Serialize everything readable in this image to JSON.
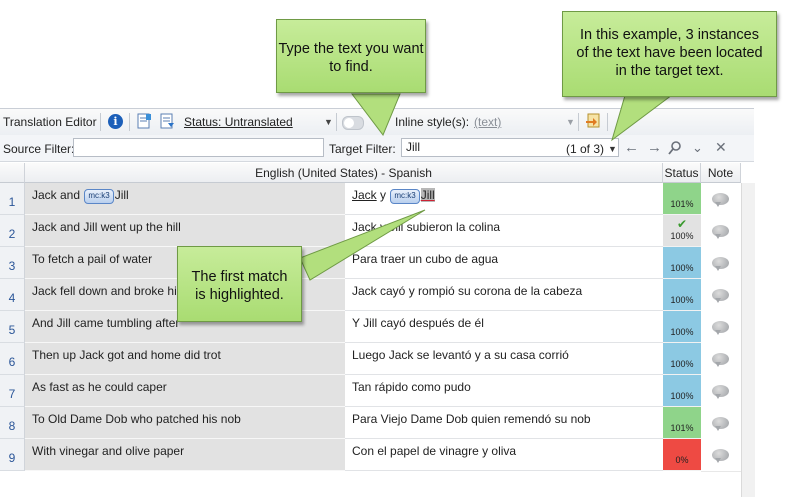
{
  "toolbar": {
    "title": "Translation Editor",
    "status_label": "Status: Untranslated",
    "inline_styles_label": "Inline style(s):",
    "inline_styles_value": "(text)"
  },
  "filters": {
    "source_label": "Source Filter:",
    "source_value": "",
    "target_label": "Target Filter:",
    "target_value": "Jill",
    "match_count": "(1 of 3)"
  },
  "grid": {
    "language_header": "English (United States) - Spanish",
    "status_header": "Status",
    "note_header": "Note",
    "rows": [
      {
        "num": "1",
        "source_pre": "Jack and ",
        "source_tag": "mc:k3",
        "source_post": "Jill",
        "target_pre": "Jack",
        "target_mid": " y ",
        "target_tag": "mc:k3",
        "target_hl": "Jill",
        "status": "101%",
        "color": "#8fd48a"
      },
      {
        "num": "2",
        "source": "Jack and Jill went up the hill",
        "target": "Jack y Jill subieron la colina",
        "status": "100%",
        "color": "#e2e2e2"
      },
      {
        "num": "3",
        "source": "To fetch a pail of water",
        "target": "Para traer un cubo de agua",
        "status": "100%",
        "color": "#8cc9e3"
      },
      {
        "num": "4",
        "source": "Jack fell down and broke his crown",
        "target": "Jack cayó y rompió su corona de la cabeza",
        "status": "100%",
        "color": "#8cc9e3"
      },
      {
        "num": "5",
        "source": "And Jill came tumbling after",
        "target": "Y Jill cayó después de él",
        "status": "100%",
        "color": "#8cc9e3"
      },
      {
        "num": "6",
        "source": "Then up Jack got and home did trot",
        "target": "Luego Jack se levantó y a su casa corrió",
        "status": "100%",
        "color": "#8cc9e3"
      },
      {
        "num": "7",
        "source": "As fast as he could caper",
        "target": "Tan rápido como pudo",
        "status": "100%",
        "color": "#8cc9e3"
      },
      {
        "num": "8",
        "source": "To Old Dame Dob who patched his nob",
        "target": "Para Viejo Dame Dob quien remendó su nob",
        "status": "101%",
        "color": "#8fd48a"
      },
      {
        "num": "9",
        "source": "With vinegar and olive paper",
        "target": "Con el papel de vinagre y oliva",
        "status": "0%",
        "color": "#ee4a43"
      }
    ]
  },
  "callouts": {
    "type_text": "Type the text you want to find.",
    "instances": "In this example, 3 instances of the text have been located in the target text.",
    "first_match": "The first match is highlighted."
  },
  "colors": {
    "callout": "#b7e383",
    "matched_101": "#8fd48a",
    "exact_100": "#8cc9e3",
    "untranslated": "#ee4a43"
  },
  "icons": [
    "info-icon",
    "document-icon",
    "export-icon",
    "toggle-switch",
    "insert-icon",
    "arrow-left-icon",
    "arrow-right-icon",
    "find-icon",
    "chevron-down-icon",
    "close-icon",
    "checkmark-icon",
    "note-bubble-icon"
  ]
}
